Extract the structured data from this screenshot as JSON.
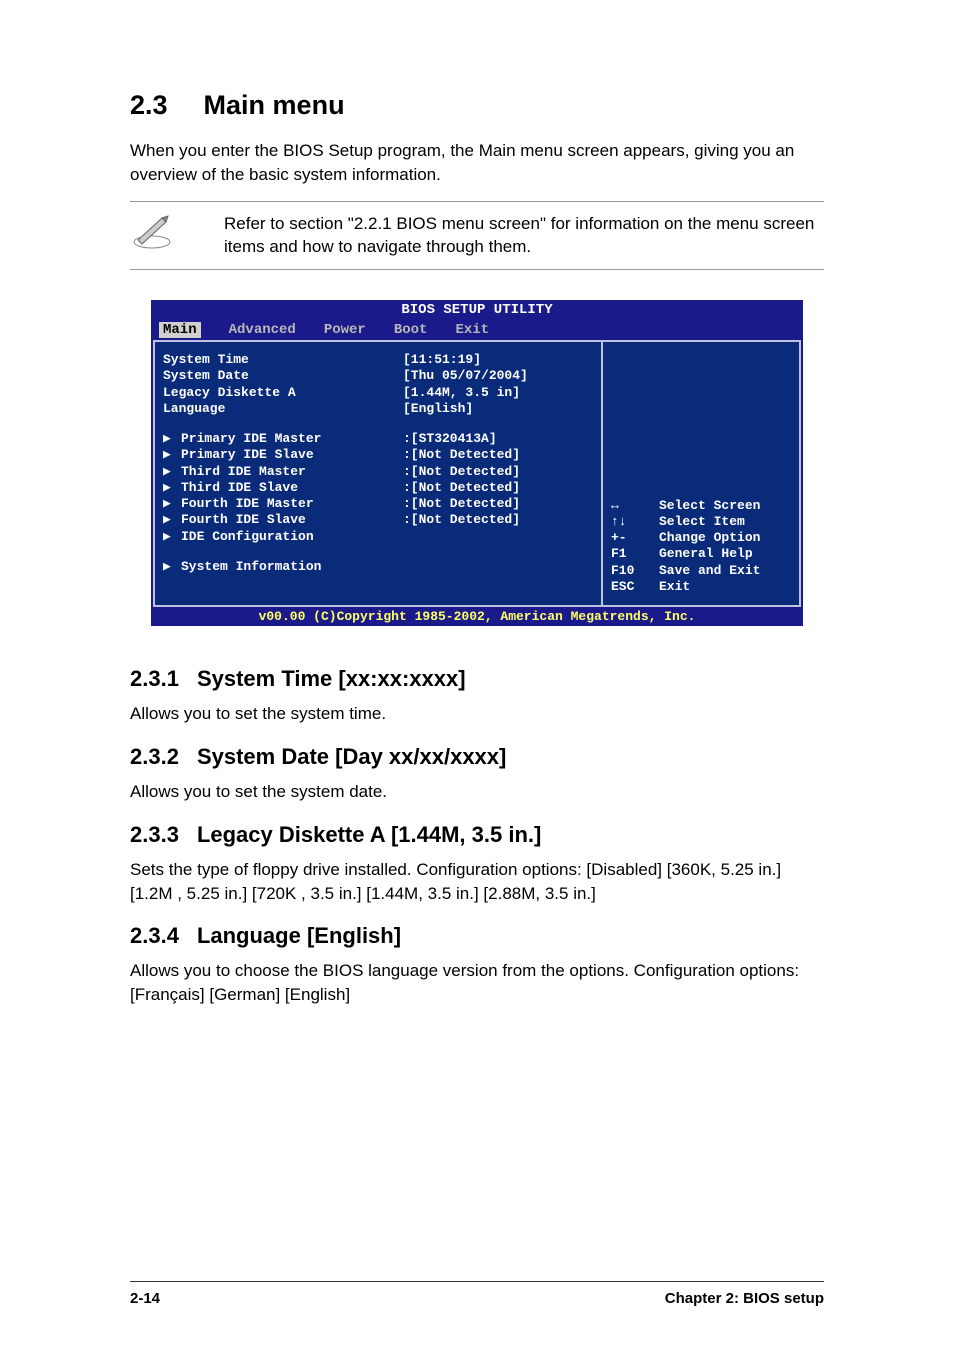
{
  "section": {
    "number": "2.3",
    "title": "Main menu",
    "intro": "When you enter the BIOS Setup program, the Main menu screen appears, giving you an overview of the basic system information."
  },
  "note": {
    "text": "Refer to section \"2.2.1 BIOS menu screen\" for information on the menu screen items and how to navigate through them."
  },
  "bios": {
    "title": "BIOS SETUP UTILITY",
    "menu": [
      "Main",
      "Advanced",
      "Power",
      "Boot",
      "Exit"
    ],
    "active_menu": 0,
    "top_rows": [
      {
        "label": "System Time",
        "value": "[11:51:19]"
      },
      {
        "label": "System Date",
        "value": "[Thu 05/07/2004]"
      },
      {
        "label": "Legacy Diskette A",
        "value": "[1.44M, 3.5 in]"
      },
      {
        "label": "Language",
        "value": "[English]"
      }
    ],
    "ide_rows": [
      {
        "label": "Primary IDE Master",
        "value": ":[ST320413A]"
      },
      {
        "label": "Primary IDE Slave",
        "value": ":[Not Detected]"
      },
      {
        "label": "Third IDE Master",
        "value": ":[Not Detected]"
      },
      {
        "label": "Third IDE Slave",
        "value": ":[Not Detected]"
      },
      {
        "label": "Fourth IDE Master",
        "value": ":[Not Detected]"
      },
      {
        "label": "Fourth IDE Slave",
        "value": ":[Not Detected]"
      },
      {
        "label": "IDE Configuration",
        "value": ""
      }
    ],
    "sysinfo_row": {
      "label": "System Information",
      "value": ""
    },
    "help": [
      {
        "key": "↔",
        "desc": "Select Screen"
      },
      {
        "key": "↑↓",
        "desc": "Select Item"
      },
      {
        "key": "+-",
        "desc": "Change Option"
      },
      {
        "key": "F1",
        "desc": "General Help"
      },
      {
        "key": "F10",
        "desc": "Save and Exit"
      },
      {
        "key": "ESC",
        "desc": "Exit"
      }
    ],
    "footer": "v00.00 (C)Copyright 1985-2002, American Megatrends, Inc."
  },
  "subsections": [
    {
      "num": "2.3.1",
      "title": "System Time [xx:xx:xxxx]",
      "body": "Allows you to set the system time."
    },
    {
      "num": "2.3.2",
      "title": "System Date [Day xx/xx/xxxx]",
      "body": "Allows you to set the system date."
    },
    {
      "num": "2.3.3",
      "title": "Legacy Diskette A [1.44M, 3.5 in.]",
      "body": "Sets the type of floppy drive installed. Configuration options: [Disabled] [360K, 5.25 in.] [1.2M , 5.25 in.] [720K , 3.5 in.] [1.44M, 3.5 in.] [2.88M, 3.5 in.]"
    },
    {
      "num": "2.3.4",
      "title": "Language [English]",
      "body": "Allows you to choose the BIOS language version from the options. Configuration options: [Français] [German] [English]"
    }
  ],
  "footer": {
    "page": "2-14",
    "chapter": "Chapter 2: BIOS setup"
  }
}
